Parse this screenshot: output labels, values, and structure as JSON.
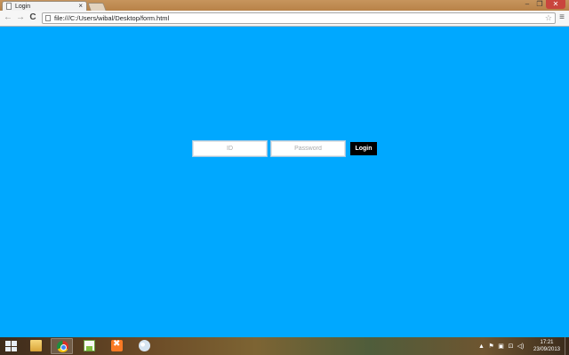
{
  "browser": {
    "tab_title": "Login",
    "tab_close": "×",
    "url": "file:///C:/Users/wibal/Desktop/form.html",
    "window_controls": {
      "minimize": "–",
      "restore": "❐",
      "close": "✕"
    },
    "nav": {
      "back": "←",
      "forward": "→",
      "reload": "C",
      "menu": "≡",
      "star": "☆"
    }
  },
  "login_form": {
    "id_placeholder": "ID",
    "password_placeholder": "Password",
    "submit_label": "Login"
  },
  "taskbar": {
    "apps": [
      "file-explorer-icon",
      "chrome-icon",
      "notepad-icon",
      "xampp-icon",
      "paint-icon"
    ],
    "tray": {
      "up_arrow": "▲",
      "flag": "⚑",
      "network": "▣",
      "display": "⊡",
      "volume": "◁)"
    },
    "time": "17:21",
    "date": "23/09/2013"
  },
  "colors": {
    "page_background": "#00a8ff",
    "login_button": "#000000"
  }
}
